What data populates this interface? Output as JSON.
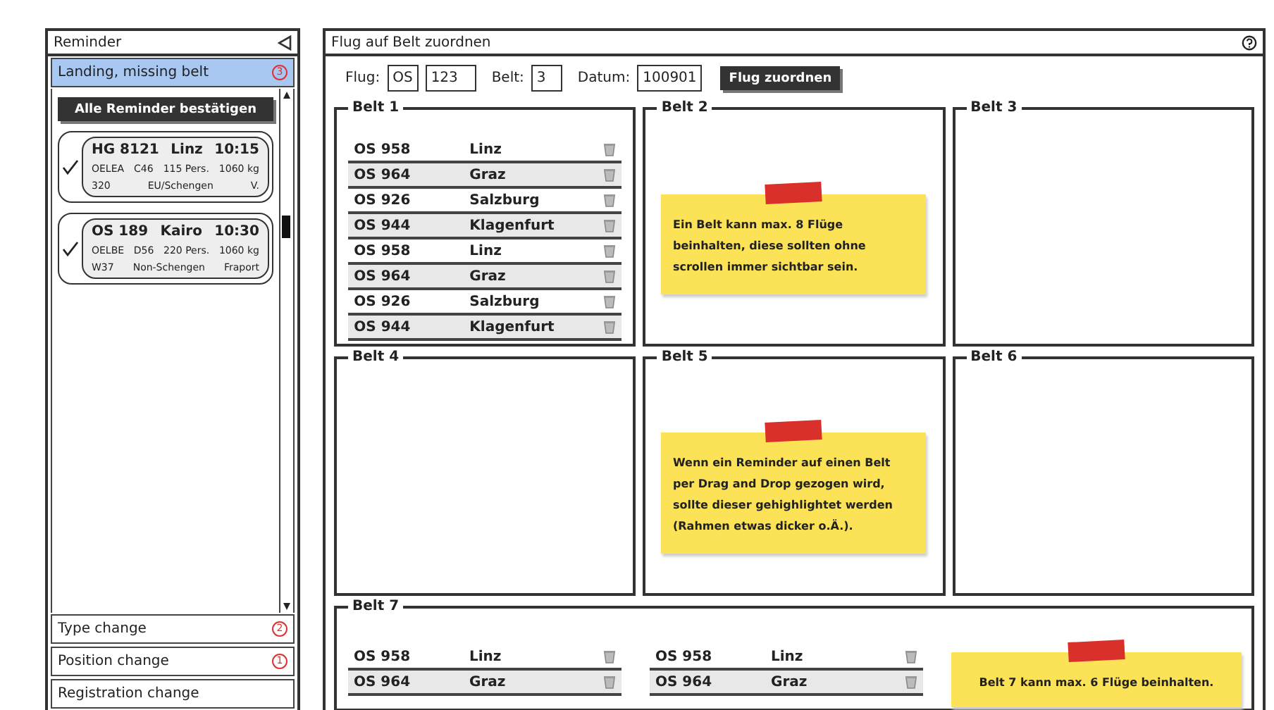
{
  "reminder_panel": {
    "title": "Reminder",
    "groups": [
      {
        "label": "Landing, missing belt",
        "badge": "3",
        "selected": true,
        "confirm_button": "Alle Reminder bestätigen",
        "reminders": [
          {
            "checked": true,
            "flight": "HG 8121",
            "destination": "Linz",
            "time": "10:15",
            "lines": [
              [
                "OELEA",
                "C46",
                "115 Pers.",
                "1060 kg"
              ],
              [
                "320",
                "EU/Schengen",
                "V."
              ]
            ]
          },
          {
            "checked": true,
            "flight": "OS 189",
            "destination": "Kairo",
            "time": "10:30",
            "lines": [
              [
                "OELBE",
                "D56",
                "220 Pers.",
                "1060 kg"
              ],
              [
                "W37",
                "Non-Schengen",
                "Fraport"
              ]
            ]
          }
        ]
      },
      {
        "label": "Type change",
        "badge": "2",
        "selected": false
      },
      {
        "label": "Position change",
        "badge": "1",
        "selected": false
      },
      {
        "label": "Registration change",
        "selected": false
      }
    ]
  },
  "assign_panel": {
    "title": "Flug auf Belt zuordnen",
    "form": {
      "fields": [
        {
          "label": "Flug:",
          "values": [
            "OS",
            "123"
          ]
        },
        {
          "label": "Belt:",
          "values": [
            "3"
          ]
        },
        {
          "label": "Datum:",
          "values": [
            "100901"
          ]
        }
      ],
      "button": "Flug zuordnen"
    },
    "belts": [
      {
        "name": "Belt 1",
        "columns": [
          [
            {
              "flight": "OS 958",
              "city": "Linz"
            },
            {
              "flight": "OS 964",
              "city": "Graz"
            },
            {
              "flight": "OS 926",
              "city": "Salzburg"
            },
            {
              "flight": "OS 944",
              "city": "Klagenfurt"
            },
            {
              "flight": "OS 958",
              "city": "Linz"
            },
            {
              "flight": "OS 964",
              "city": "Graz"
            },
            {
              "flight": "OS 926",
              "city": "Salzburg"
            },
            {
              "flight": "OS 944",
              "city": "Klagenfurt"
            }
          ]
        ]
      },
      {
        "name": "Belt 2",
        "note": "Ein Belt kann max. 8 Flüge beinhalten, diese sollten ohne scrollen immer sichtbar sein."
      },
      {
        "name": "Belt 3"
      },
      {
        "name": "Belt 4"
      },
      {
        "name": "Belt 5",
        "note": "Wenn ein Reminder auf einen Belt per Drag and Drop gezogen wird, sollte dieser gehighlightet werden (Rahmen etwas dicker o.Ä.)."
      },
      {
        "name": "Belt 6"
      },
      {
        "name": "Belt 7",
        "columns": [
          [
            {
              "flight": "OS 958",
              "city": "Linz"
            },
            {
              "flight": "OS 964",
              "city": "Graz"
            }
          ],
          [
            {
              "flight": "OS 958",
              "city": "Linz"
            },
            {
              "flight": "OS 964",
              "city": "Graz"
            }
          ]
        ],
        "note": "Belt 7 kann max. 6 Flüge beinhalten."
      }
    ]
  }
}
